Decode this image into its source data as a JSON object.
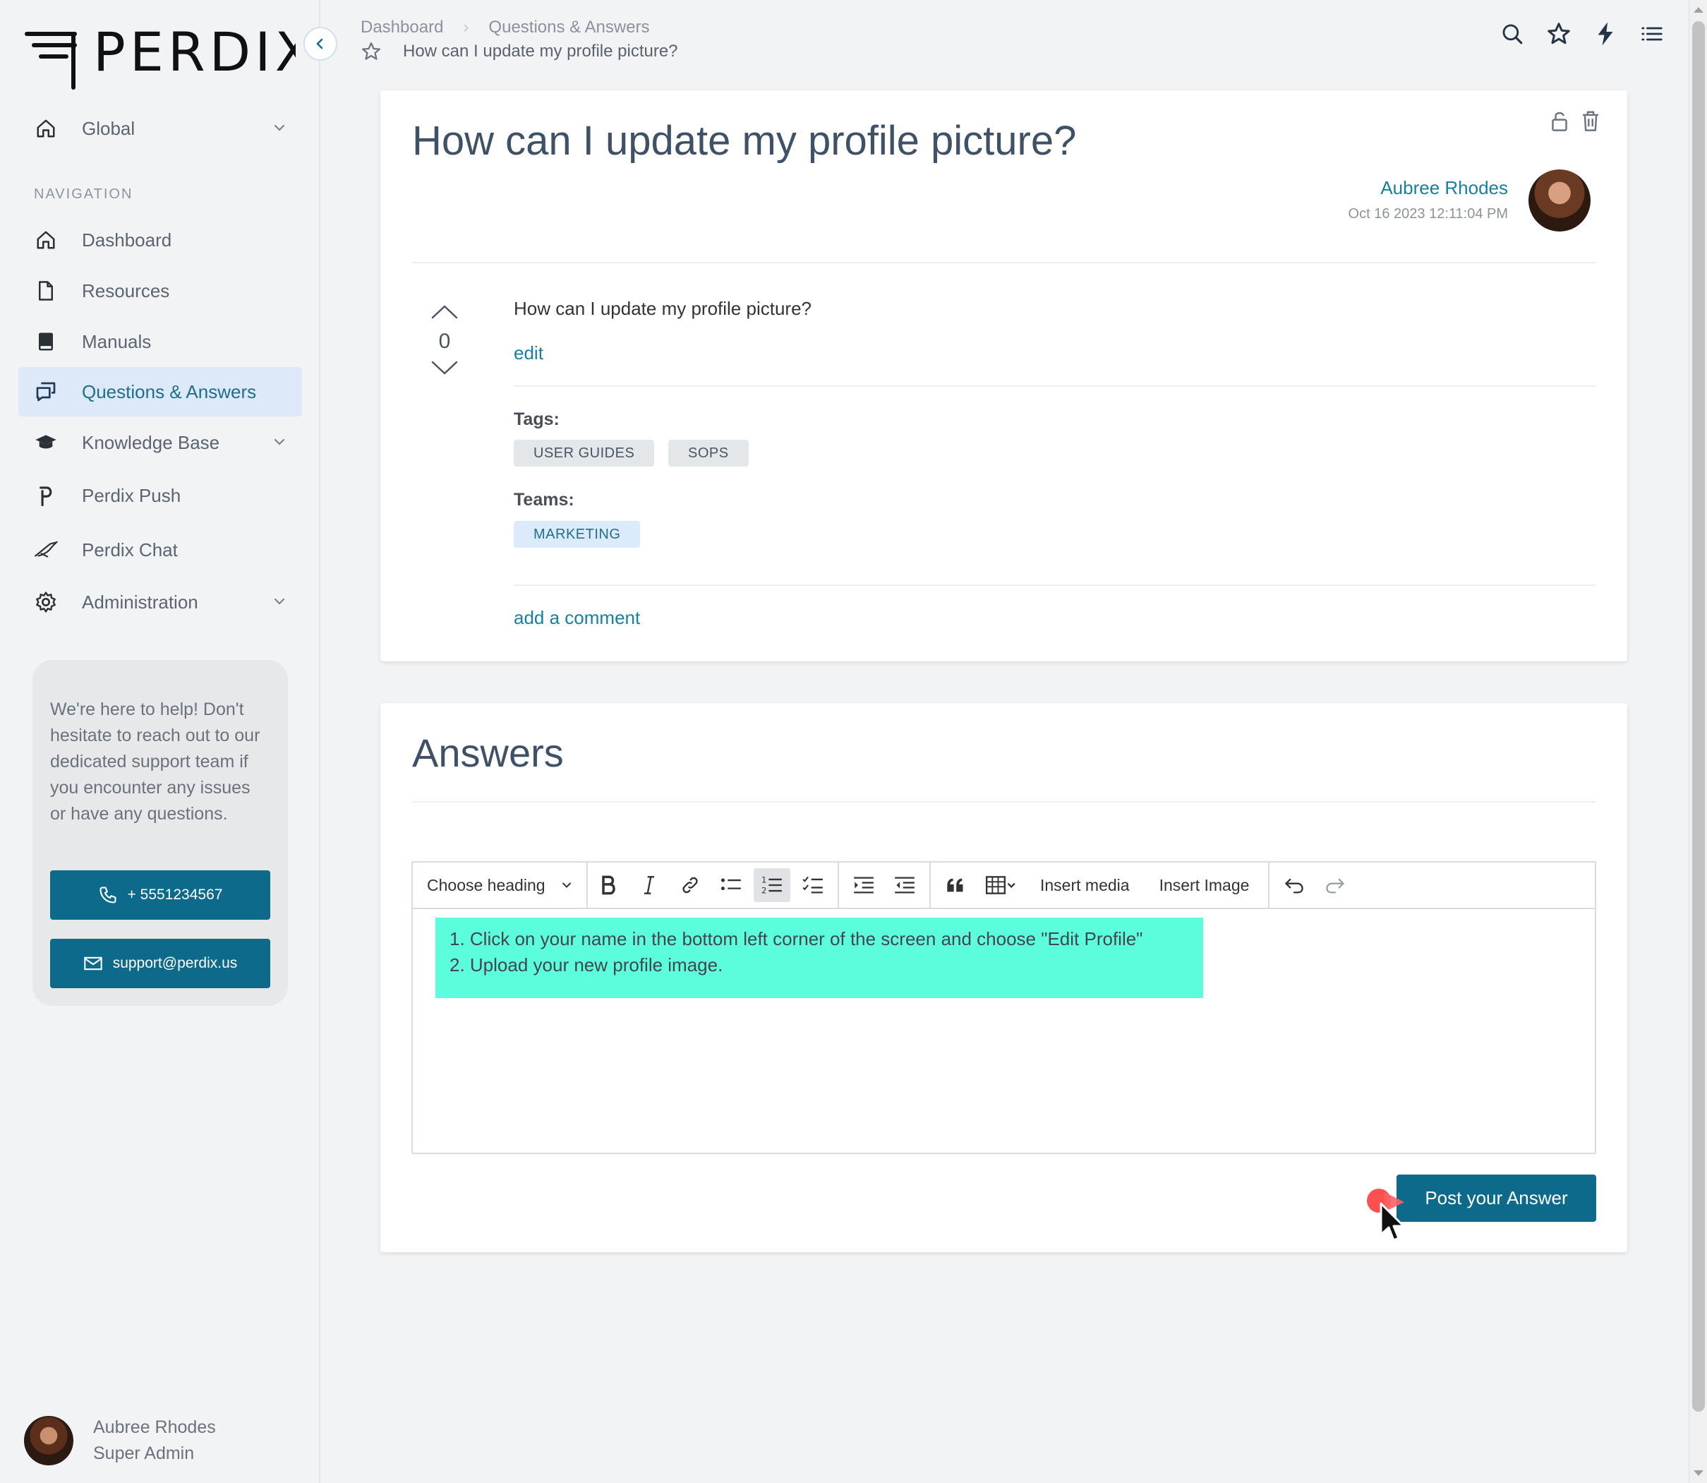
{
  "app": {
    "logo_text": "PERDIX"
  },
  "sidebar": {
    "workspace": "Global",
    "section_label": "NAVIGATION",
    "items": [
      {
        "label": "Dashboard",
        "icon": "home-icon"
      },
      {
        "label": "Resources",
        "icon": "file-icon"
      },
      {
        "label": "Manuals",
        "icon": "book-icon"
      },
      {
        "label": "Questions & Answers",
        "icon": "chat-icon",
        "active": true
      },
      {
        "label": "Knowledge Base",
        "icon": "graduation-cap-icon"
      },
      {
        "label": "Perdix Push",
        "icon": "perdix-p-icon"
      },
      {
        "label": "Perdix Chat",
        "icon": "bird-icon"
      },
      {
        "label": "Administration",
        "icon": "gear-icon"
      }
    ],
    "help": {
      "text": "We're here to help! Don't hesitate to reach out to our dedicated support team if you encounter any issues or have any questions.",
      "phone": "+ 5551234567",
      "email": "support@perdix.us"
    },
    "user": {
      "name": "Aubree Rhodes",
      "role": "Super Admin"
    }
  },
  "header": {
    "breadcrumb": [
      "Dashboard",
      "Questions & Answers"
    ],
    "page_title": "How can I update my profile picture?",
    "icons": [
      "search-icon",
      "star-icon",
      "lightning-icon",
      "list-icon"
    ]
  },
  "question": {
    "title": "How can I update my profile picture?",
    "author": "Aubree Rhodes",
    "date": "Oct 16 2023 12:11:04 PM",
    "votes": "0",
    "body": "How can I update my profile picture?",
    "edit_label": "edit",
    "tags_label": "Tags:",
    "tags": [
      "USER GUIDES",
      "SOPS"
    ],
    "teams_label": "Teams:",
    "teams": [
      "MARKETING"
    ],
    "comment_label": "add a comment"
  },
  "answers": {
    "title": "Answers",
    "toolbar": {
      "heading": "Choose heading",
      "insert_media": "Insert media",
      "insert_image": "Insert Image"
    },
    "draft": [
      "1. Click on your name in the bottom left corner of the screen and choose \"Edit Profile\"",
      "2. Upload your new profile image."
    ],
    "post_label": "Post your Answer",
    "highlight_color": "#5bfddc"
  },
  "colors": {
    "accent": "#0e6a8a",
    "link": "#177fa0",
    "active_nav_bg": "#dde9f8"
  }
}
